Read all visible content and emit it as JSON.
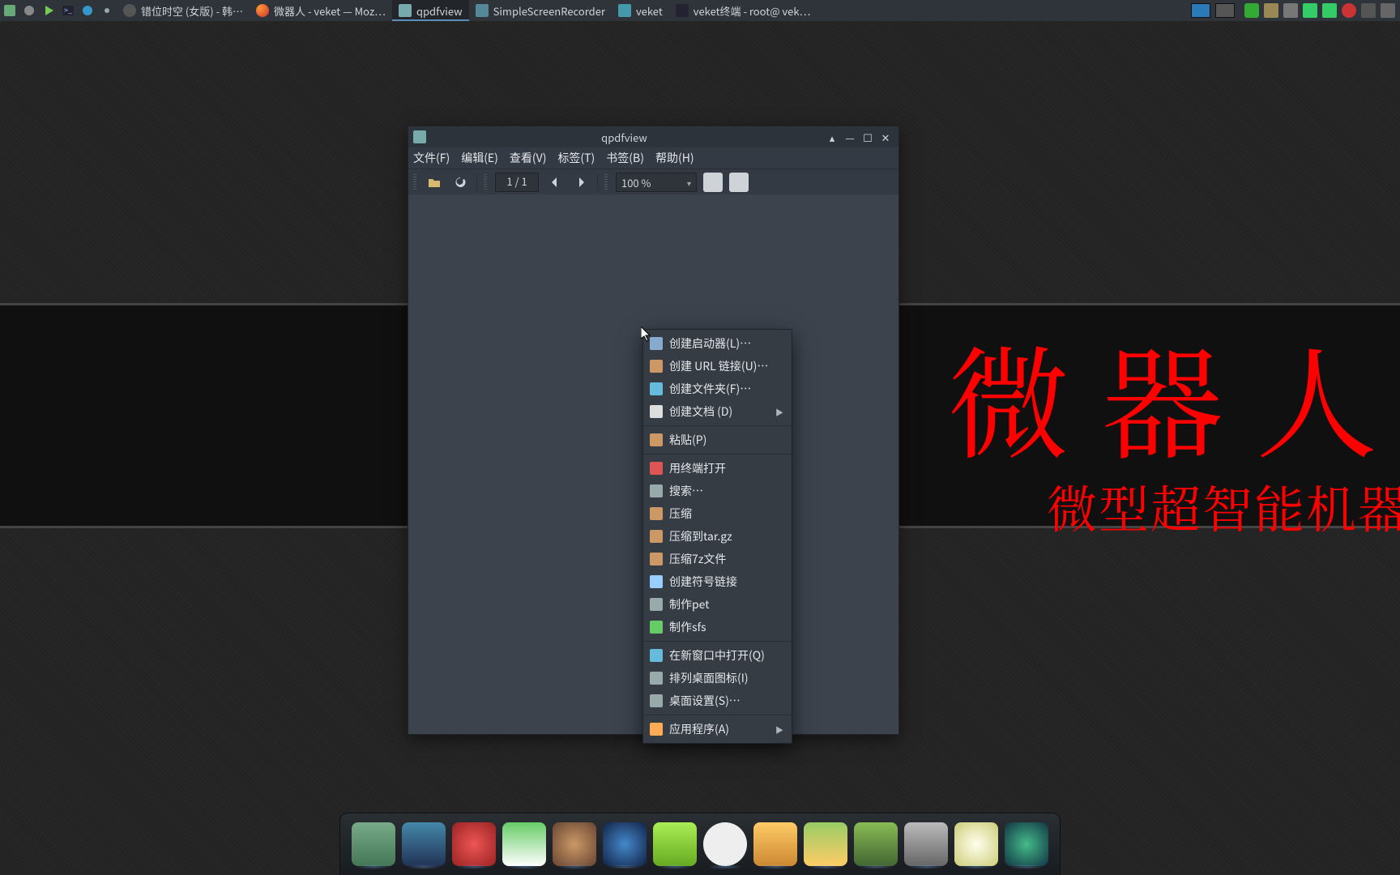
{
  "panel": {
    "launchers": [
      "apps",
      "tools",
      "play",
      "terminal",
      "web",
      "indicator"
    ],
    "tasks": [
      {
        "label": "错位时空 (女版) - 韩…",
        "active": false
      },
      {
        "label": "微器人 - veket — Moz…",
        "active": false
      },
      {
        "label": "qpdfview",
        "active": true
      },
      {
        "label": "SimpleScreenRecorder",
        "active": false
      },
      {
        "label": "veket",
        "active": false
      },
      {
        "label": "veket终端 - root@ vek…",
        "active": false
      }
    ],
    "tray": [
      "shield",
      "clipboard",
      "volume",
      "network",
      "battery",
      "record",
      "lang",
      "keyboard"
    ]
  },
  "wallpaper": {
    "big": "微器人",
    "sub": "微型超智能机器"
  },
  "window": {
    "title": "qpdfview",
    "menus": [
      "文件(F)",
      "编辑(E)",
      "查看(V)",
      "标签(T)",
      "书签(B)",
      "帮助(H)"
    ],
    "page": "1 / 1",
    "zoom": "100 %"
  },
  "context": {
    "groups": [
      [
        {
          "label": "创建启动器(L)…",
          "icon": "launcher"
        },
        {
          "label": "创建 URL 链接(U)…",
          "icon": "link"
        },
        {
          "label": "创建文件夹(F)…",
          "icon": "folder"
        },
        {
          "label": "创建文档 (D)",
          "icon": "doc",
          "sub": true
        }
      ],
      [
        {
          "label": "粘贴(P)",
          "icon": "paste"
        }
      ],
      [
        {
          "label": "用终端打开",
          "icon": "term"
        },
        {
          "label": "搜索…",
          "icon": "search"
        },
        {
          "label": "压缩",
          "icon": "pack"
        },
        {
          "label": "压缩到tar.gz",
          "icon": "targz"
        },
        {
          "label": "压缩7z文件",
          "icon": "7z"
        },
        {
          "label": "创建符号链接",
          "icon": "symlink"
        },
        {
          "label": "制作pet",
          "icon": "pet"
        },
        {
          "label": "制作sfs",
          "icon": "sfs"
        }
      ],
      [
        {
          "label": "在新窗口中打开(Q)",
          "icon": "newwin"
        },
        {
          "label": "排列桌面图标(I)",
          "icon": "sort"
        },
        {
          "label": "桌面设置(S)…",
          "icon": "settings"
        }
      ],
      [
        {
          "label": "应用程序(A)",
          "icon": "apps",
          "sub": true
        }
      ]
    ]
  },
  "dock": {
    "items": [
      "files",
      "display",
      "strawberry",
      "paint",
      "gimp",
      "audio",
      "chat",
      "tux",
      "folder",
      "office",
      "help",
      "disk",
      "brightness",
      "camera"
    ]
  }
}
